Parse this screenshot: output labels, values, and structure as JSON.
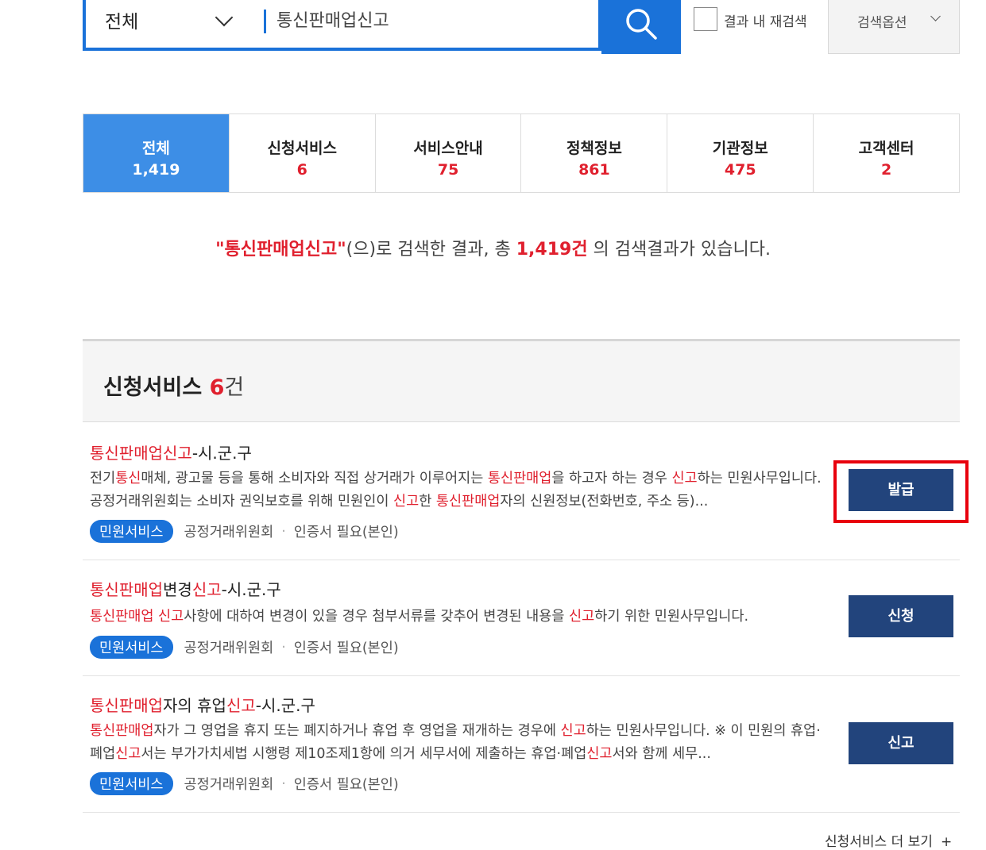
{
  "search": {
    "scope": "전체",
    "query": "통신판매업신고",
    "rescan_label": "결과 내 재검색",
    "options_label": "검색옵션"
  },
  "tabs": [
    {
      "label": "전체",
      "count": "1,419"
    },
    {
      "label": "신청서비스",
      "count": "6"
    },
    {
      "label": "서비스안내",
      "count": "75"
    },
    {
      "label": "정책정보",
      "count": "861"
    },
    {
      "label": "기관정보",
      "count": "475"
    },
    {
      "label": "고객센터",
      "count": "2"
    }
  ],
  "summary": {
    "keyword": "\"통신판매업신고\"",
    "middle": "(으)로 검색한 결과, 총 ",
    "count": "1,419건",
    "end": " 의 검색결과가 있습니다."
  },
  "section": {
    "title": "신청서비스",
    "count": "6",
    "unit": "건"
  },
  "items": [
    {
      "title_parts": [
        {
          "t": "통신판매업신고",
          "hl": true
        },
        {
          "t": "-시.군.구",
          "hl": false
        }
      ],
      "desc_parts": [
        {
          "t": "전기",
          "hl": false
        },
        {
          "t": "통신",
          "hl": true
        },
        {
          "t": "매체, 광고물 등을 통해 소비자와 직접 상거래가 이루어지는 ",
          "hl": false
        },
        {
          "t": "통신판매업",
          "hl": true
        },
        {
          "t": "을 하고자 하는 경우 ",
          "hl": false
        },
        {
          "t": "신고",
          "hl": true
        },
        {
          "t": "하는 민원사무입니다. 공정거래위원회는 소비자 권익보호를 위해 민원인이 ",
          "hl": false
        },
        {
          "t": "신고",
          "hl": true
        },
        {
          "t": "한 ",
          "hl": false
        },
        {
          "t": "통신판매업",
          "hl": true
        },
        {
          "t": "자의 신원정보(전화번호, 주소 등)...",
          "hl": false
        }
      ],
      "tag": "민원서비스",
      "agency": "공정거래위원회",
      "cert": "인증서 필요(본인)",
      "button": "발급"
    },
    {
      "title_parts": [
        {
          "t": "통신판매업",
          "hl": true
        },
        {
          "t": "변경",
          "hl": false
        },
        {
          "t": "신고",
          "hl": true
        },
        {
          "t": "-시.군.구",
          "hl": false
        }
      ],
      "desc_parts": [
        {
          "t": "통신판매업 신고",
          "hl": true
        },
        {
          "t": "사항에 대하여 변경이 있을 경우 첨부서류를 갖추어 변경된 내용을 ",
          "hl": false
        },
        {
          "t": "신고",
          "hl": true
        },
        {
          "t": "하기 위한 민원사무입니다.",
          "hl": false
        }
      ],
      "tag": "민원서비스",
      "agency": "공정거래위원회",
      "cert": "인증서 필요(본인)",
      "button": "신청"
    },
    {
      "title_parts": [
        {
          "t": "통신판매업",
          "hl": true
        },
        {
          "t": "자의 휴업",
          "hl": false
        },
        {
          "t": "신고",
          "hl": true
        },
        {
          "t": "-시.군.구",
          "hl": false
        }
      ],
      "desc_parts": [
        {
          "t": "통신판매업",
          "hl": true
        },
        {
          "t": "자가 그 영업을 휴지 또는 폐지하거나 휴업 후 영업을 재개하는 경우에 ",
          "hl": false
        },
        {
          "t": "신고",
          "hl": true
        },
        {
          "t": "하는 민원사무입니다. ※ 이 민원의 휴업·폐업",
          "hl": false
        },
        {
          "t": "신고",
          "hl": true
        },
        {
          "t": "서는 부가가치세법 시행령 제10조제1항에 의거 세무서에 제출하는 휴업·폐업",
          "hl": false
        },
        {
          "t": "신고",
          "hl": true
        },
        {
          "t": "서와 함께 세무...",
          "hl": false
        }
      ],
      "tag": "민원서비스",
      "agency": "공정거래위원회",
      "cert": "인증서 필요(본인)",
      "button": "신고"
    }
  ],
  "more_label": "신청서비스 더 보기",
  "more_icon": "+"
}
